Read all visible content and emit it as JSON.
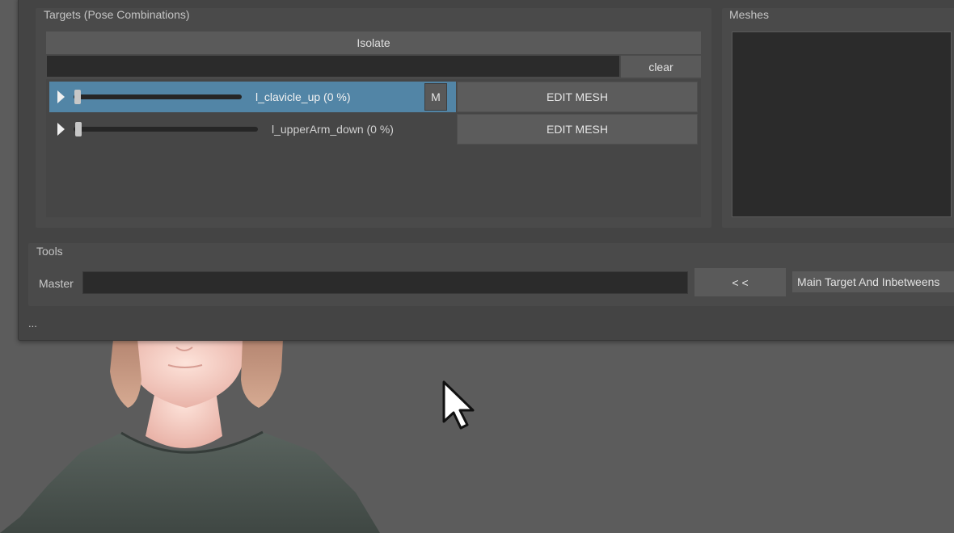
{
  "targets_group": {
    "title": "Targets (Pose Combinations)",
    "isolate_label": "Isolate",
    "filter_value": "",
    "clear_label": "clear",
    "rows": [
      {
        "label": "l_clavicle_up (0 %)",
        "value": 0,
        "selected": true,
        "m_label": "M",
        "edit_label": "EDIT MESH"
      },
      {
        "label": "l_upperArm_down (0 %)",
        "value": 0,
        "selected": false,
        "edit_label": "EDIT MESH"
      }
    ]
  },
  "meshes_group": {
    "title": "Meshes"
  },
  "tools_group": {
    "title": "Tools",
    "master_label": "Master",
    "master_value": "",
    "arrow_button_label": "< <",
    "mode_value": "Main Target And Inbetweens"
  },
  "status": {
    "ellipsis": "..."
  },
  "colors": {
    "selection": "#5285a6",
    "window_bg": "#444444",
    "field_bg": "#2b2b2b",
    "viewport_bg": "#5c5c5c",
    "shirt": "#4d5651",
    "skin": "#f2c9bf",
    "hair": "#c0917a"
  },
  "icons": {
    "expand": "triangle-right-icon",
    "cursor": "mouse-pointer-icon"
  }
}
